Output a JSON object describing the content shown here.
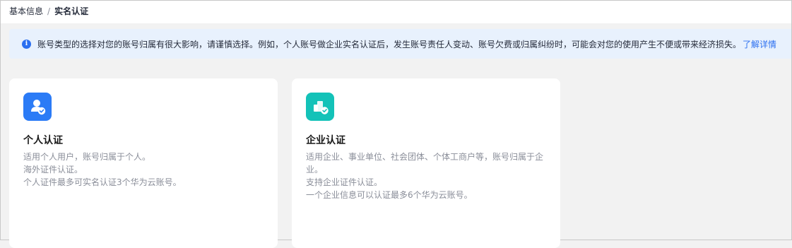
{
  "breadcrumb": {
    "parent": "基本信息",
    "separator": "/",
    "current": "实名认证"
  },
  "notice": {
    "icon": "info-icon",
    "text": "账号类型的选择对您的账号归属有很大影响，请谨慎选择。例如，个人账号做企业实名认证后，发生账号责任人变动、账号欠费或归属纠纷时，可能会对您的使用产生不便或带来经济损失。",
    "link": "了解详情",
    "accent": "#2b6ff0",
    "background": "#e8f1fd"
  },
  "cards": [
    {
      "icon": "user-verified-icon",
      "icon_color": "#2b7bf6",
      "title": "个人认证",
      "lines": [
        "适用个人用户，账号归属于个人。",
        "海外证件认证。",
        "个人证件最多可实名认证3个华为云账号。"
      ]
    },
    {
      "icon": "enterprise-verified-icon",
      "icon_color": "#13c2b8",
      "title": "企业认证",
      "lines": [
        "适用企业、事业单位、社会团体、个体工商户等，账号归属于企",
        "业。",
        "支持企业证件认证。",
        "一个企业信息可以认证最多6个华为云账号。"
      ]
    }
  ]
}
